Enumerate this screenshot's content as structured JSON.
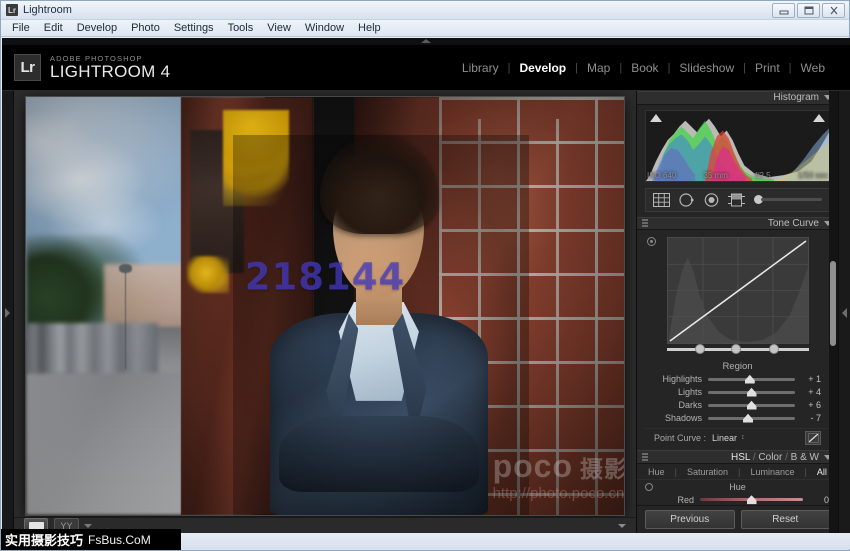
{
  "window": {
    "title": "Lightroom",
    "badge": "Lr",
    "minimize": "minimize",
    "maximize": "maximize",
    "close": "close"
  },
  "menubar": {
    "items": [
      "File",
      "Edit",
      "Develop",
      "Photo",
      "Settings",
      "Tools",
      "View",
      "Window",
      "Help"
    ]
  },
  "identity": {
    "badge": "Lr",
    "brand_small": "ADOBE PHOTOSHOP",
    "brand_big": "LIGHTROOM 4"
  },
  "modules": {
    "items": [
      "Library",
      "Develop",
      "Map",
      "Book",
      "Slideshow",
      "Print",
      "Web"
    ],
    "active": "Develop",
    "separator": "|"
  },
  "histogram": {
    "title": "Histogram",
    "exif": {
      "iso": "ISO 640",
      "focal": "35 mm",
      "aperture": "f/2.5",
      "shutter": "1/50 sec"
    },
    "clip_left": "shadow-clipping-indicator",
    "clip_right": "highlight-clipping-indicator"
  },
  "toolstrip": {
    "tools": [
      {
        "name": "crop-overlay-tool"
      },
      {
        "name": "spot-removal-tool"
      },
      {
        "name": "red-eye-correction-tool"
      },
      {
        "name": "graduated-filter-tool"
      },
      {
        "name": "adjustment-brush-tool"
      }
    ]
  },
  "tone_curve": {
    "title": "Tone Curve",
    "region_label": "Region",
    "sliders": [
      {
        "label": "Highlights",
        "value": "+ 1",
        "pos": 48
      },
      {
        "label": "Lights",
        "value": "+ 4",
        "pos": 50
      },
      {
        "label": "Darks",
        "value": "+ 6",
        "pos": 50
      },
      {
        "label": "Shadows",
        "value": "- 7",
        "pos": 46
      }
    ],
    "point_curve_label": "Point Curve :",
    "point_curve_value": "Linear",
    "point_curve_caret": "↕"
  },
  "hsl": {
    "title_hsl": "HSL",
    "title_color": "Color",
    "title_bw": "B & W",
    "separator": "/",
    "tabs": [
      "Hue",
      "Saturation",
      "Luminance",
      "All"
    ],
    "active_tab": "All",
    "section_label": "Hue",
    "sliders": [
      {
        "label": "Red",
        "value": "0",
        "pos": 50
      }
    ]
  },
  "right_panel_buttons": {
    "previous": "Previous",
    "reset": "Reset"
  },
  "photo_toolbar": {
    "view_mode_button": "loupe-view",
    "compare_label": "YY",
    "caret": "▼"
  },
  "watermarks": {
    "center": "218144",
    "poco_brand": "poco",
    "poco_cn": "摄影专题",
    "poco_url": "http://photo.poco.cn/",
    "fsbus_cn": "实用摄影技巧",
    "fsbus_en": "FsBus.CoM"
  },
  "colors": {
    "app_bg": "#1e1e1e",
    "panel_bg": "#252525",
    "accent_text": "#ffffff",
    "muted_text": "#8e8e8e",
    "watermark_blue": "#463cc8"
  }
}
